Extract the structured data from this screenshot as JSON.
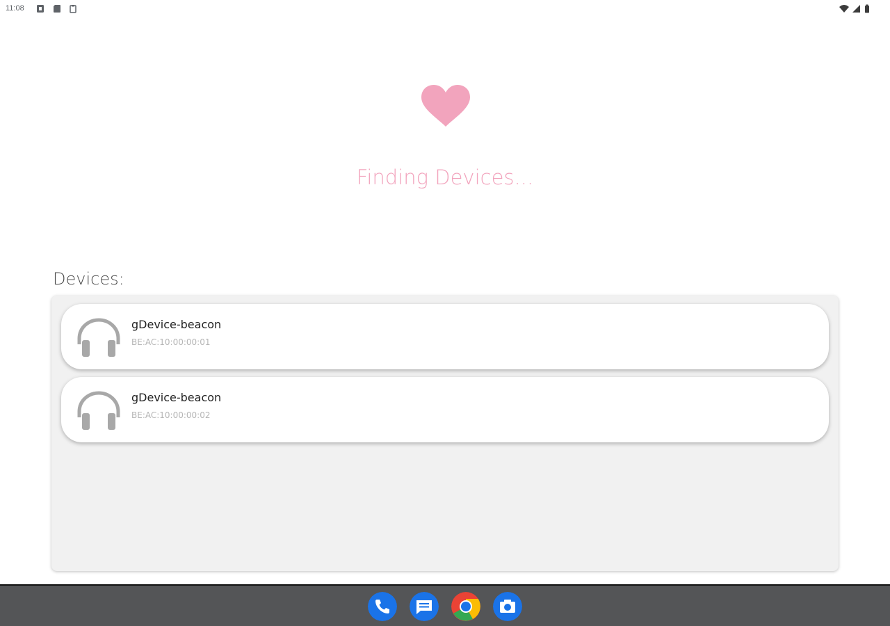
{
  "status_bar": {
    "time": "11:08",
    "left_icons": [
      "notification-icon",
      "sd-card-icon",
      "clipboard-icon"
    ],
    "right_icons": [
      "wifi-icon",
      "signal-icon",
      "battery-icon"
    ]
  },
  "hero": {
    "icon": "heart-icon",
    "accent_color": "#f2a4bd",
    "status_text": "Finding Devices..."
  },
  "devices": {
    "label": "Devices:",
    "items": [
      {
        "icon": "headphones-icon",
        "name": "gDevice-beacon",
        "address": "BE:AC:10:00:00:01"
      },
      {
        "icon": "headphones-icon",
        "name": "gDevice-beacon",
        "address": "BE:AC:10:00:00:02"
      }
    ]
  },
  "taskbar": {
    "apps": [
      {
        "name": "phone-app",
        "color": "#1a73e8"
      },
      {
        "name": "messages-app",
        "color": "#1a73e8"
      },
      {
        "name": "chrome-app",
        "color": "#34a853"
      },
      {
        "name": "camera-app",
        "color": "#1a73e8"
      }
    ]
  }
}
